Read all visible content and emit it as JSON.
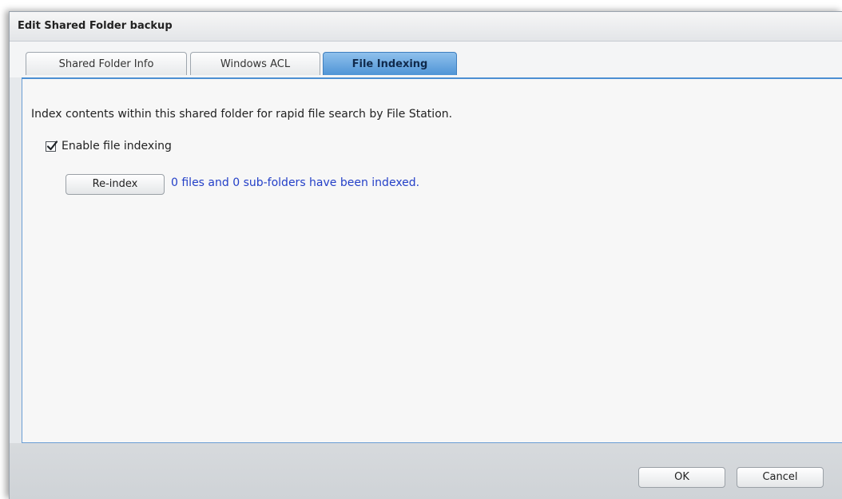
{
  "dialog": {
    "title": "Edit Shared Folder backup"
  },
  "tabs": [
    {
      "label": "Shared Folder Info",
      "active": false
    },
    {
      "label": "Windows ACL",
      "active": false
    },
    {
      "label": "File Indexing",
      "active": true
    }
  ],
  "content": {
    "description": "Index contents within this shared folder for rapid file search by File Station.",
    "enable_indexing": {
      "label": "Enable file indexing",
      "checked": true
    },
    "reindex_button_label": "Re-index",
    "status_text": "0 files and 0 sub-folders have been indexed.",
    "status_color": "#2440c8"
  },
  "footer": {
    "ok_label": "OK",
    "cancel_label": "Cancel"
  },
  "colors": {
    "accent": "#4f94d6",
    "panel_border": "#6a9ed4"
  }
}
